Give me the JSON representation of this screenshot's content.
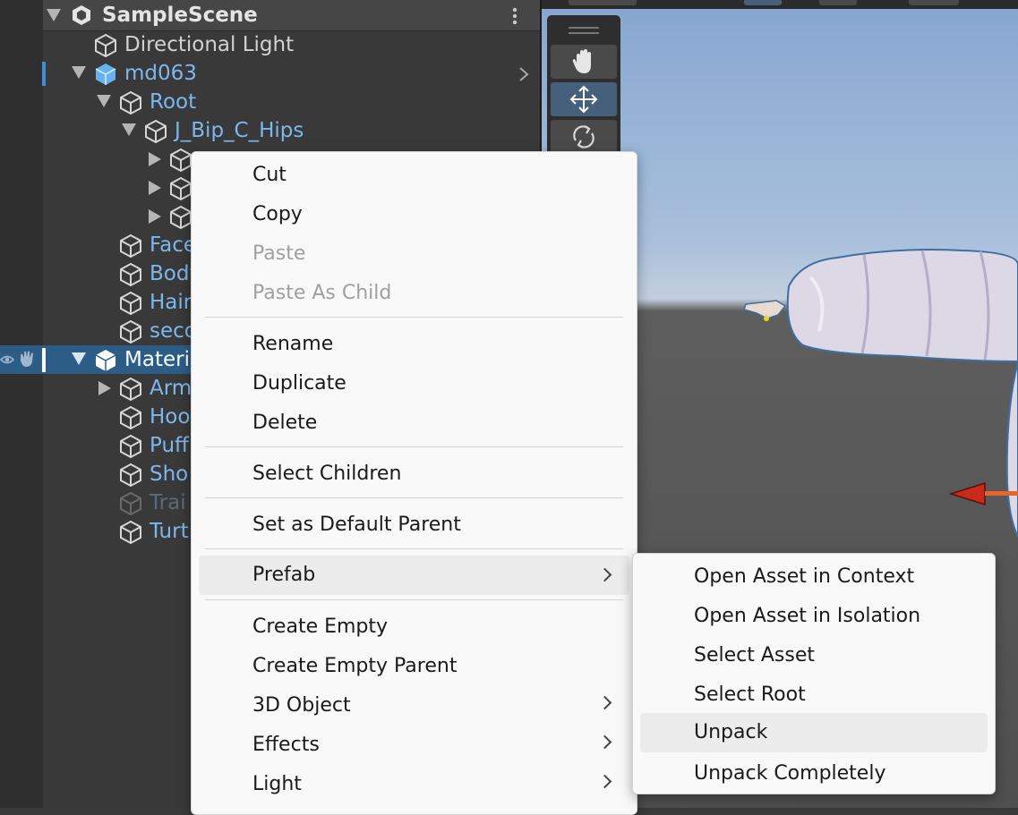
{
  "hierarchy": {
    "scene_name": "SampleScene",
    "rows": [
      {
        "label": "Directional Light"
      },
      {
        "label": "md063"
      },
      {
        "label": "Root"
      },
      {
        "label": "J_Bip_C_Hips"
      },
      {
        "label": "Face"
      },
      {
        "label": "Body"
      },
      {
        "label": "Hair"
      },
      {
        "label": "seco"
      },
      {
        "label": "Materia"
      },
      {
        "label": "Arm"
      },
      {
        "label": "Hoo"
      },
      {
        "label": "Puff"
      },
      {
        "label": "Sho"
      },
      {
        "label": "Trai"
      },
      {
        "label": "Turt"
      }
    ]
  },
  "context_menu": {
    "cut": "Cut",
    "copy": "Copy",
    "paste": "Paste",
    "paste_as_child": "Paste As Child",
    "rename": "Rename",
    "duplicate": "Duplicate",
    "delete": "Delete",
    "select_children": "Select Children",
    "set_default_parent": "Set as Default Parent",
    "prefab": "Prefab",
    "create_empty": "Create Empty",
    "create_empty_parent": "Create Empty Parent",
    "object_3d": "3D Object",
    "effects": "Effects",
    "light": "Light"
  },
  "prefab_submenu": {
    "open_in_context": "Open Asset in Context",
    "open_in_isolation": "Open Asset in Isolation",
    "select_asset": "Select Asset",
    "select_root": "Select Root",
    "unpack": "Unpack",
    "unpack_completely": "Unpack Completely"
  },
  "colors": {
    "hierarchy_bg": "#393939",
    "selection": "#2c5d87",
    "prefab_text": "#7cb8ee",
    "menu_bg": "#f9f9f9"
  }
}
